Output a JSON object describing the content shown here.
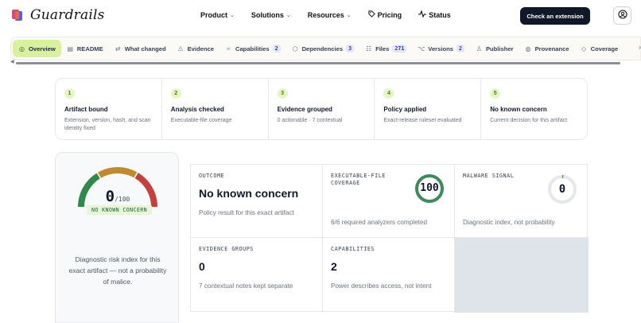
{
  "header": {
    "brand": "Guardrails",
    "nav": [
      {
        "label": "Product",
        "chevron": true,
        "icon": ""
      },
      {
        "label": "Solutions",
        "chevron": true,
        "icon": ""
      },
      {
        "label": "Resources",
        "chevron": true,
        "icon": ""
      },
      {
        "label": "Pricing",
        "chevron": false,
        "icon": "tag-icon"
      },
      {
        "label": "Status",
        "chevron": false,
        "icon": "pulse-icon"
      }
    ],
    "cta": "Check an extension",
    "account_icon": "user-circle-icon"
  },
  "tabs": [
    {
      "label": "Overview",
      "icon": "radar-icon",
      "count": "",
      "active": true
    },
    {
      "label": "README",
      "icon": "document-icon",
      "count": "",
      "active": false
    },
    {
      "label": "What changed",
      "icon": "diff-icon",
      "count": "",
      "active": false
    },
    {
      "label": "Evidence",
      "icon": "warning-icon",
      "count": "",
      "active": false
    },
    {
      "label": "Capabilities",
      "icon": "plug-icon",
      "count": "2",
      "active": false
    },
    {
      "label": "Dependencies",
      "icon": "cube-icon",
      "count": "3",
      "active": false
    },
    {
      "label": "Files",
      "icon": "files-icon",
      "count": "271",
      "active": false
    },
    {
      "label": "Versions",
      "icon": "branch-icon",
      "count": "2",
      "active": false
    },
    {
      "label": "Publisher",
      "icon": "person-icon",
      "count": "",
      "active": false
    },
    {
      "label": "Provenance",
      "icon": "globe-icon",
      "count": "",
      "active": false
    },
    {
      "label": "Coverage",
      "icon": "shield-icon",
      "count": "",
      "active": false
    }
  ],
  "steps": [
    {
      "num": "1",
      "title": "Artifact bound",
      "desc": "Extension, version, hash, and scan identity fixed"
    },
    {
      "num": "2",
      "title": "Analysis checked",
      "desc": "Executable-file coverage"
    },
    {
      "num": "3",
      "title": "Evidence grouped",
      "desc": "0 actionable · 7 contextual"
    },
    {
      "num": "4",
      "title": "Policy applied",
      "desc": "Exact-release ruleset evaluated"
    },
    {
      "num": "5",
      "title": "No known concern",
      "desc": "Current decision for this artifact"
    }
  ],
  "gauge": {
    "score": "0",
    "max": "/100",
    "value": 0,
    "badge": "NO KNOWN CONCERN",
    "note": "Diagnostic risk index for this exact artifact — not a probability of malice.",
    "colors": {
      "green": "#2f8a4a",
      "amber": "#c08a2e",
      "red": "#c2413f"
    }
  },
  "metrics": {
    "outcome": {
      "label": "OUTCOME",
      "value": "No known concern",
      "note": "Policy result for this exact artifact"
    },
    "coverage": {
      "label": "EXECUTABLE-FILE COVERAGE",
      "value": "100",
      "percent": 100,
      "note": "6/6 required analyzers completed",
      "color": "#3f8a5c"
    },
    "malware": {
      "label": "MALWARE SIGNAL",
      "value": "0",
      "percent": 0,
      "note": "Diagnostic index, not probability",
      "color": "#3f8a5c"
    },
    "evidence": {
      "label": "EVIDENCE GROUPS",
      "value": "0",
      "note": "7 contextual notes kept separate"
    },
    "capabilities": {
      "label": "CAPABILITIES",
      "value": "2",
      "note": "Power describes access, not intent"
    }
  }
}
